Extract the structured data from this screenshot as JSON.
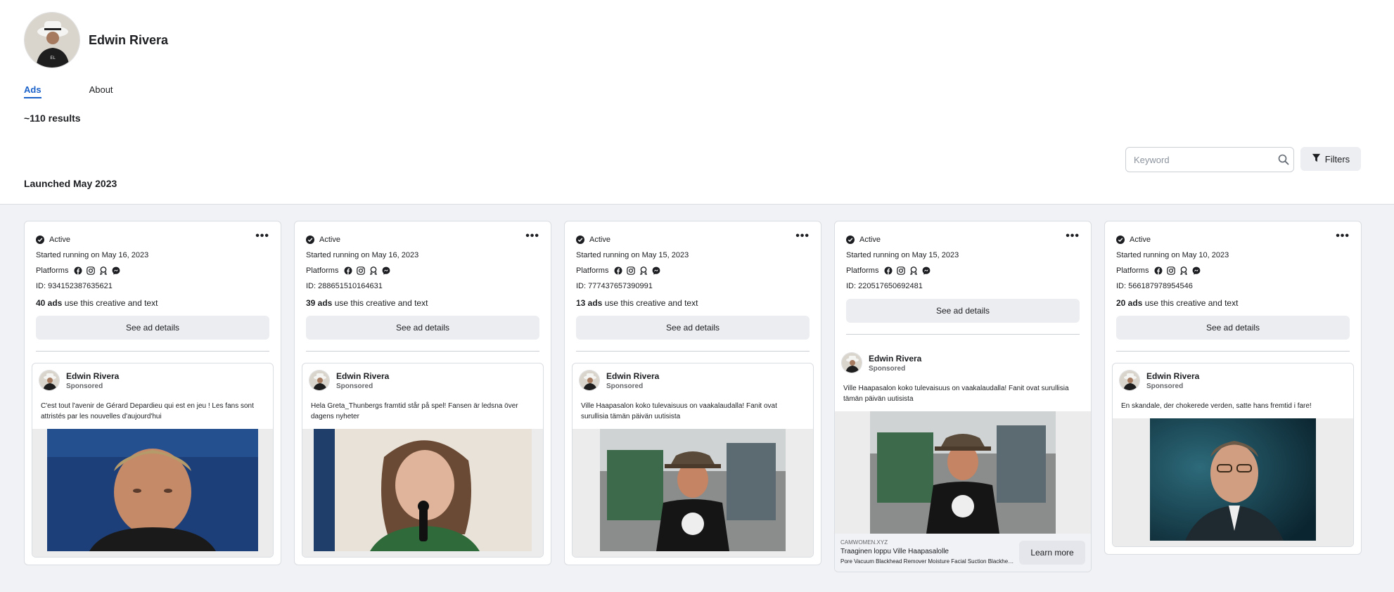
{
  "profile": {
    "name": "Edwin Rivera"
  },
  "tabs": [
    {
      "label": "Ads",
      "active": true
    },
    {
      "label": "About",
      "active": false
    }
  ],
  "results_text": "~110 results",
  "section_title": "Launched May 2023",
  "search": {
    "placeholder": "Keyword"
  },
  "filters_label": "Filters",
  "colors": {
    "accent": "#1a61c9",
    "background": "#f0f2f5"
  },
  "cards": [
    {
      "status": "Active",
      "started": "Started running on May 16, 2023",
      "platforms_label": "Platforms",
      "platform_icons": [
        "facebook-icon",
        "instagram-icon",
        "audience-network-icon",
        "messenger-icon"
      ],
      "id": "ID: 934152387635621",
      "ads_count": "40 ads",
      "ads_suffix": " use this creative and text",
      "details_label": "See ad details",
      "preview": {
        "name": "Edwin Rivera",
        "sponsored": "Sponsored",
        "text": "C'est tout l'avenir de Gérard Depardieu qui est en jeu ! Les fans sont attristés par les nouvelles d'aujourd'hui"
      }
    },
    {
      "status": "Active",
      "started": "Started running on May 16, 2023",
      "platforms_label": "Platforms",
      "platform_icons": [
        "facebook-icon",
        "instagram-icon",
        "audience-network-icon",
        "messenger-icon"
      ],
      "id": "ID: 288651510164631",
      "ads_count": "39 ads",
      "ads_suffix": " use this creative and text",
      "details_label": "See ad details",
      "preview": {
        "name": "Edwin Rivera",
        "sponsored": "Sponsored",
        "text": "Hela Greta_Thunbergs framtid står på spel! Fansen är ledsna över dagens nyheter"
      }
    },
    {
      "status": "Active",
      "started": "Started running on May 15, 2023",
      "platforms_label": "Platforms",
      "platform_icons": [
        "facebook-icon",
        "instagram-icon",
        "audience-network-icon",
        "messenger-icon"
      ],
      "id": "ID: 777437657390991",
      "ads_count": "13 ads",
      "ads_suffix": " use this creative and text",
      "details_label": "See ad details",
      "preview": {
        "name": "Edwin Rivera",
        "sponsored": "Sponsored",
        "text": "Ville Haapasalon koko tulevaisuus on vaakalaudalla! Fanit ovat surullisia tämän päivän uutisista"
      }
    },
    {
      "status": "Active",
      "started": "Started running on May 15, 2023",
      "platforms_label": "Platforms",
      "platform_icons": [
        "facebook-icon",
        "instagram-icon",
        "audience-network-icon",
        "messenger-icon"
      ],
      "id": "ID: 220517650692481",
      "details_label": "See ad details",
      "preview": {
        "name": "Edwin Rivera",
        "sponsored": "Sponsored",
        "text": "Ville Haapasalon koko tulevaisuus on vaakalaudalla! Fanit ovat surullisia tämän päivän uutisista",
        "cta_domain": "CAMWOMEN.XYZ",
        "cta_title": "Traaginen loppu Ville Haapasalolle",
        "cta_desc": "Pore Vacuum Blackhead Remover Moisture Facial Suction Blackheads Black Spots Blackheads Removal Deep Cleansing Tool",
        "cta_button": "Learn more"
      }
    },
    {
      "status": "Active",
      "started": "Started running on May 10, 2023",
      "platforms_label": "Platforms",
      "platform_icons": [
        "facebook-icon",
        "instagram-icon",
        "audience-network-icon",
        "messenger-icon"
      ],
      "id": "ID: 566187978954546",
      "ads_count": "20 ads",
      "ads_suffix": " use this creative and text",
      "details_label": "See ad details",
      "preview": {
        "name": "Edwin Rivera",
        "sponsored": "Sponsored",
        "text": "En skandale, der chokerede verden, satte hans fremtid i fare!"
      }
    }
  ]
}
